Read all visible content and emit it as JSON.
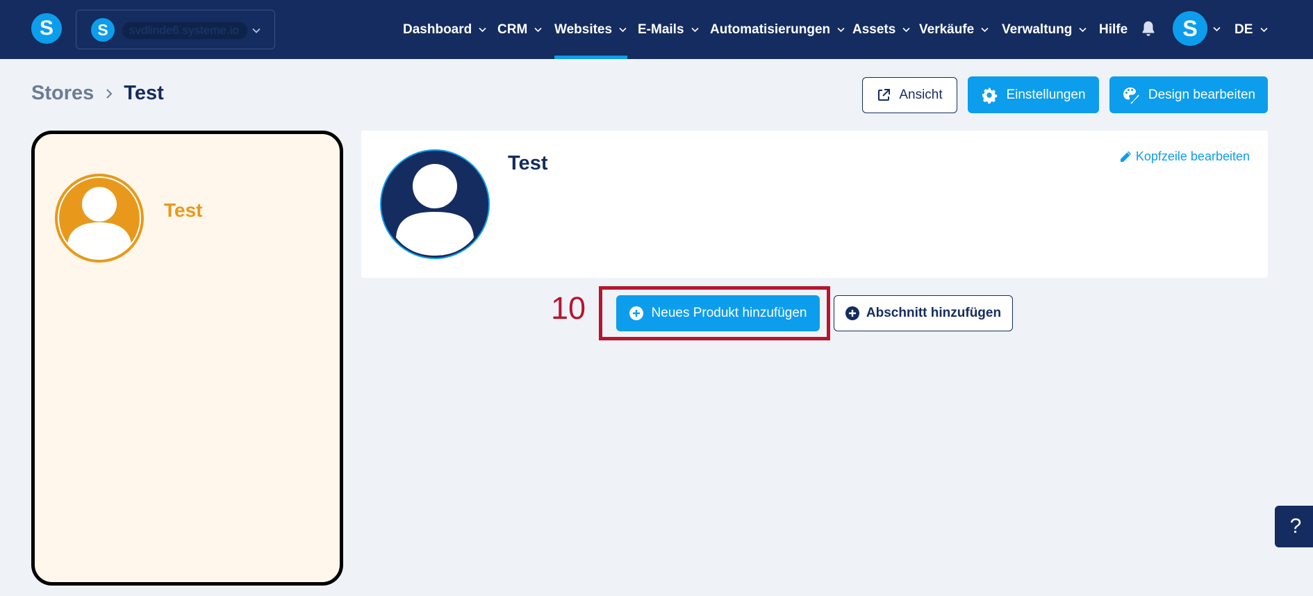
{
  "app": {
    "logo_letter": "S",
    "site_switcher": {
      "logo_letter": "S",
      "domain": "svdlinde6.systeme.io"
    },
    "avatar_letter": "S",
    "language": "DE"
  },
  "nav": [
    {
      "label": "Dashboard",
      "has_dropdown": true
    },
    {
      "label": "CRM",
      "has_dropdown": true
    },
    {
      "label": "Websites",
      "has_dropdown": true,
      "active": true
    },
    {
      "label": "E-Mails",
      "has_dropdown": true
    },
    {
      "label": "Automatisierungen",
      "has_dropdown": true
    },
    {
      "label": "Assets",
      "has_dropdown": true
    },
    {
      "label": "Verkäufe",
      "has_dropdown": true
    },
    {
      "label": "Verwaltung",
      "has_dropdown": true
    },
    {
      "label": "Hilfe",
      "has_dropdown": false
    }
  ],
  "breadcrumb": {
    "parent": "Stores",
    "current": "Test"
  },
  "header_actions": {
    "view_label": "Ansicht",
    "settings_label": "Einstellungen",
    "design_label": "Design bearbeiten"
  },
  "preview": {
    "name": "Test",
    "accent_color": "#e8991b"
  },
  "store_header": {
    "title": "Test",
    "edit_label": "Kopfzeile bearbeiten"
  },
  "actions": {
    "step_number": "10",
    "add_product_label": "Neues Produkt hinzufügen",
    "add_section_label": "Abschnitt hinzufügen"
  },
  "help": {
    "label": "?"
  },
  "colors": {
    "navy": "#142c5f",
    "brand_blue": "#0d9ded",
    "highlight_red": "#b8142e",
    "background": "#eff3f8"
  },
  "icons": {
    "bell": "bell-icon",
    "external_link": "external-link-icon",
    "settings": "gear-icon",
    "design": "palette-icon",
    "edit": "pencil-icon",
    "add": "plus-circle-icon"
  }
}
